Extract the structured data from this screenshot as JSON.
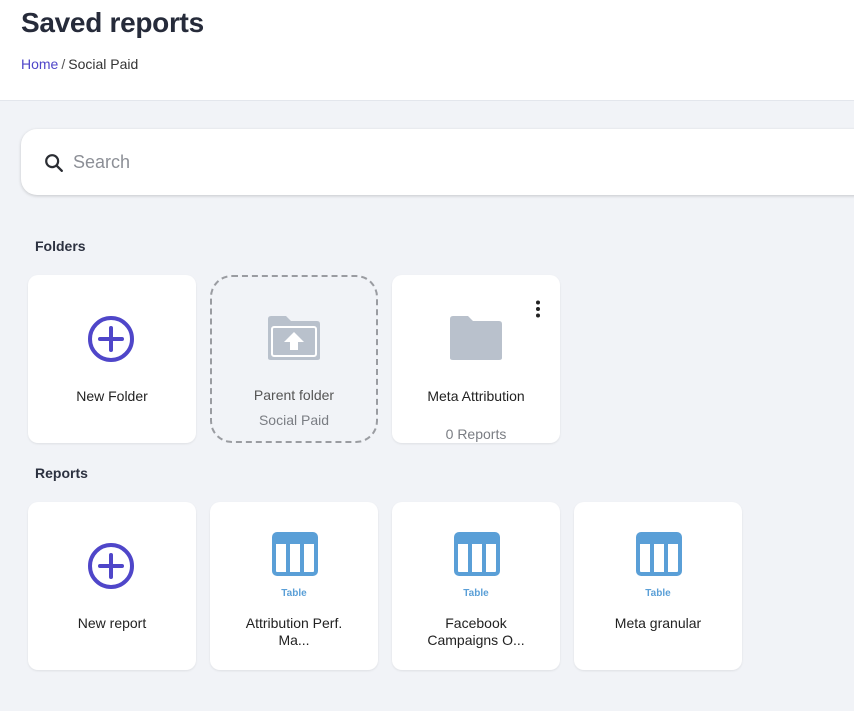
{
  "header": {
    "title": "Saved reports",
    "breadcrumb": {
      "home": "Home",
      "separator": "/",
      "current": "Social Paid"
    }
  },
  "search": {
    "placeholder": "Search",
    "icon": "search-icon"
  },
  "folders": {
    "heading": "Folders",
    "new_folder": {
      "label": "New Folder",
      "icon": "plus-circle-icon"
    },
    "parent_folder": {
      "label": "Parent folder",
      "sublabel": "Social Paid",
      "icon": "folder-up-icon"
    },
    "items": [
      {
        "label": "Meta Attribution",
        "count": "0 Reports",
        "icon": "folder-icon",
        "menu_icon": "kebab-menu-icon"
      }
    ]
  },
  "reports": {
    "heading": "Reports",
    "new_report": {
      "label": "New report",
      "icon": "plus-circle-icon"
    },
    "items": [
      {
        "type": "Table",
        "label": "Attribution Perf. Ma...",
        "icon": "table-icon"
      },
      {
        "type": "Table",
        "label": "Facebook Campaigns O...",
        "icon": "table-icon"
      },
      {
        "type": "Table",
        "label": "Meta granular",
        "icon": "table-icon"
      }
    ]
  },
  "colors": {
    "accent": "#4f46c9",
    "table_icon": "#5a9fd7",
    "folder_icon": "#b9c1cc",
    "background": "#f1f3f7"
  }
}
